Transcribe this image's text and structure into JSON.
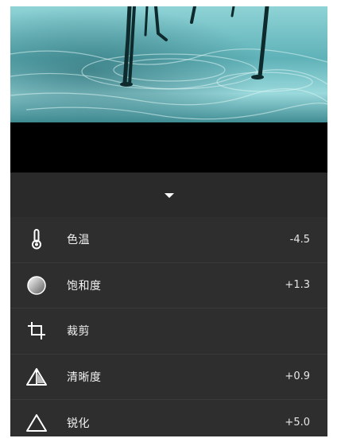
{
  "adjustments": [
    {
      "id": "temperature",
      "label": "色温",
      "value": "-4.5",
      "icon": "thermometer-icon"
    },
    {
      "id": "saturation",
      "label": "饱和度",
      "value": "+1.3",
      "icon": "saturation-circle-icon"
    },
    {
      "id": "crop",
      "label": "裁剪",
      "value": "",
      "icon": "crop-icon"
    },
    {
      "id": "clarity",
      "label": "清晰度",
      "value": "+0.9",
      "icon": "clarity-triangle-icon"
    },
    {
      "id": "sharpen",
      "label": "锐化",
      "value": "+5.0",
      "icon": "sharpen-triangle-icon"
    }
  ],
  "colors": {
    "panel": "#2e2e2e",
    "toggle_bar": "#2a2a2a",
    "divider": "#3a3a3a",
    "text": "#f2f2f2"
  }
}
